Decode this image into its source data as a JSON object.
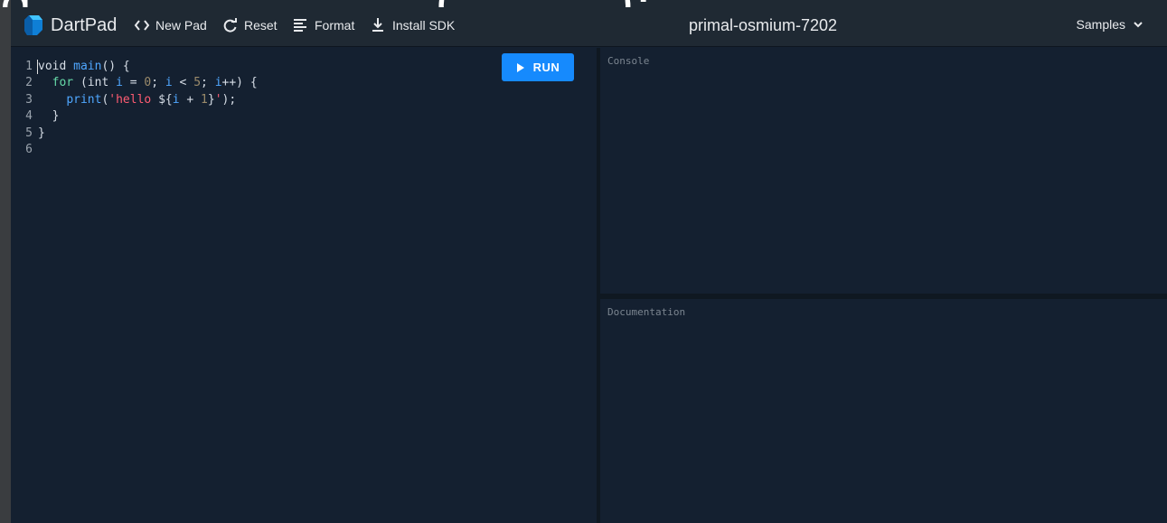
{
  "overlay": {
    "text": "g                         (          );"
  },
  "header": {
    "brand": "DartPad",
    "buttons": {
      "new_pad": "New Pad",
      "reset": "Reset",
      "format": "Format",
      "install_sdk": "Install SDK"
    },
    "pad_name": "primal-osmium-7202",
    "samples": "Samples"
  },
  "editor": {
    "line_numbers": [
      "1",
      "2",
      "3",
      "4",
      "5",
      "6"
    ],
    "lines": [
      [
        {
          "t": "void ",
          "c": ""
        },
        {
          "t": "main",
          "c": "fn"
        },
        {
          "t": "() {",
          "c": ""
        }
      ],
      [
        {
          "t": "  ",
          "c": ""
        },
        {
          "t": "for",
          "c": "kw"
        },
        {
          "t": " (int ",
          "c": ""
        },
        {
          "t": "i",
          "c": "fn"
        },
        {
          "t": " = ",
          "c": ""
        },
        {
          "t": "0",
          "c": "num"
        },
        {
          "t": "; ",
          "c": ""
        },
        {
          "t": "i",
          "c": "fn"
        },
        {
          "t": " < ",
          "c": ""
        },
        {
          "t": "5",
          "c": "num"
        },
        {
          "t": "; ",
          "c": ""
        },
        {
          "t": "i",
          "c": "fn"
        },
        {
          "t": "++) {",
          "c": ""
        }
      ],
      [
        {
          "t": "    ",
          "c": ""
        },
        {
          "t": "print",
          "c": "fn"
        },
        {
          "t": "(",
          "c": ""
        },
        {
          "t": "'hello ",
          "c": "str"
        },
        {
          "t": "${",
          "c": ""
        },
        {
          "t": "i",
          "c": "fn"
        },
        {
          "t": " + ",
          "c": ""
        },
        {
          "t": "1",
          "c": "num"
        },
        {
          "t": "}",
          "c": ""
        },
        {
          "t": "'",
          "c": "str"
        },
        {
          "t": ");",
          "c": ""
        }
      ],
      [
        {
          "t": "  }",
          "c": ""
        }
      ],
      [
        {
          "t": "}",
          "c": ""
        }
      ],
      [
        {
          "t": "",
          "c": ""
        }
      ]
    ],
    "run_label": "RUN"
  },
  "console": {
    "label": "Console"
  },
  "documentation": {
    "label": "Documentation"
  },
  "colors": {
    "accent": "#168afd",
    "background": "#142030",
    "toolbar": "#1f2933"
  },
  "icons": {
    "logo": "dart-logo-icon",
    "new_pad": "code-brackets-icon",
    "reset": "refresh-icon",
    "format": "format-lines-icon",
    "install_sdk": "download-icon",
    "run": "play-icon",
    "samples": "chevron-down-icon"
  }
}
